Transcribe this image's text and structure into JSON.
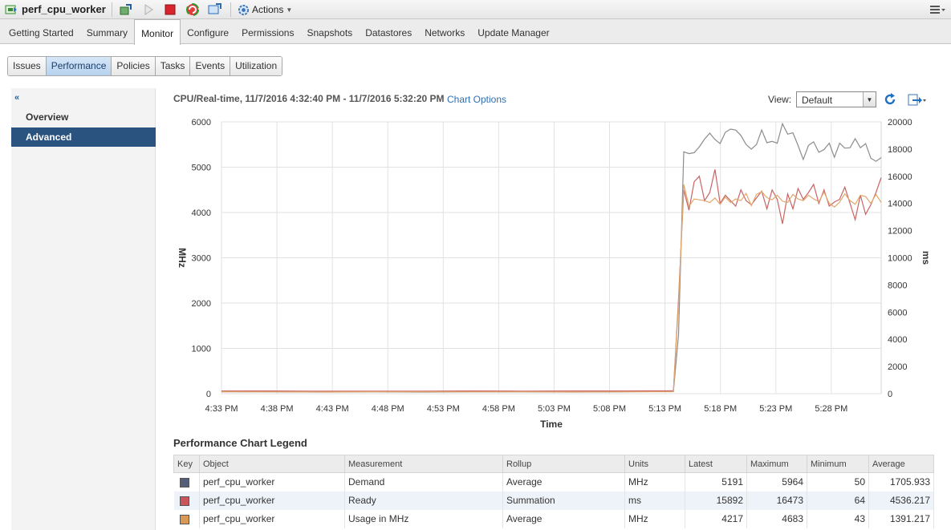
{
  "window": {
    "title": "perf_cpu_worker",
    "actions_label": "Actions"
  },
  "main_tabs": [
    {
      "label": "Getting Started"
    },
    {
      "label": "Summary"
    },
    {
      "label": "Monitor"
    },
    {
      "label": "Configure"
    },
    {
      "label": "Permissions"
    },
    {
      "label": "Snapshots"
    },
    {
      "label": "Datastores"
    },
    {
      "label": "Networks"
    },
    {
      "label": "Update Manager"
    }
  ],
  "active_main_tab": "Monitor",
  "sub_tabs": [
    {
      "label": "Issues"
    },
    {
      "label": "Performance"
    },
    {
      "label": "Policies"
    },
    {
      "label": "Tasks"
    },
    {
      "label": "Events"
    },
    {
      "label": "Utilization"
    }
  ],
  "active_sub_tab": "Performance",
  "left_nav": {
    "items": [
      {
        "label": "Overview"
      },
      {
        "label": "Advanced"
      }
    ],
    "active": "Advanced"
  },
  "chart_header": {
    "title": "CPU/Real-time, 11/7/2016 4:32:40 PM - 11/7/2016 5:32:20 PM",
    "options_link": "Chart Options",
    "view_label": "View:",
    "view_value": "Default"
  },
  "chart_data": {
    "type": "line",
    "xlabel": "Time",
    "ylabel_left": "MHz",
    "ylabel_right": "ms",
    "x_ticks": [
      "4:33 PM",
      "4:38 PM",
      "4:43 PM",
      "4:48 PM",
      "4:53 PM",
      "4:58 PM",
      "5:03 PM",
      "5:08 PM",
      "5:13 PM",
      "5:18 PM",
      "5:23 PM",
      "5:28 PM"
    ],
    "y_left_ticks": [
      0,
      1000,
      2000,
      3000,
      4000,
      5000,
      6000
    ],
    "y_right_ticks": [
      0,
      2000,
      4000,
      6000,
      8000,
      10000,
      12000,
      14000,
      16000,
      18000,
      20000
    ],
    "ylim_left": [
      0,
      6000
    ],
    "ylim_right": [
      0,
      20000
    ],
    "grid": true,
    "series": [
      {
        "name": "Demand",
        "color": "#8c8c8c",
        "axis": "left",
        "values": [
          40,
          40,
          35,
          40,
          35,
          40,
          40,
          35,
          40,
          50,
          1300,
          5340,
          5300,
          5320,
          5450,
          5620,
          5750,
          5610,
          5520,
          5770,
          5840,
          5820,
          5700,
          5500,
          5400,
          5500,
          5820,
          5540,
          5570,
          5530,
          5960,
          5730,
          5760,
          5480,
          5170,
          5480,
          5560,
          5330,
          5390,
          5530,
          5220,
          5530,
          5420,
          5430,
          5630,
          5430,
          5520,
          5200,
          5130,
          5210
        ]
      },
      {
        "name": "Ready",
        "color": "#c96464",
        "axis": "right",
        "values": [
          200,
          200,
          180,
          190,
          190,
          200,
          190,
          200,
          200,
          210,
          7000,
          15000,
          13500,
          15600,
          16000,
          14200,
          14800,
          16500,
          14000,
          14600,
          14200,
          13800,
          15000,
          14200,
          13900,
          14400,
          14900,
          13600,
          15000,
          14300,
          12500,
          14700,
          13600,
          15100,
          14300,
          14800,
          15400,
          14000,
          15000,
          13800,
          14100,
          14300,
          15200,
          14000,
          12800,
          14600,
          13200,
          13900,
          14800,
          15900
        ]
      },
      {
        "name": "Usage in MHz",
        "color": "#e0a76a",
        "axis": "left",
        "values": [
          45,
          40,
          38,
          42,
          40,
          40,
          40,
          38,
          42,
          45,
          2000,
          4620,
          4140,
          4300,
          4280,
          4260,
          4220,
          4320,
          4180,
          4340,
          4220,
          4300,
          4260,
          4420,
          4150,
          4400,
          4460,
          4330,
          4280,
          4380,
          4250,
          4220,
          4400,
          4300,
          4260,
          4380,
          4300,
          4240,
          4450,
          4200,
          4120,
          4230,
          4410,
          4260,
          4180,
          4380,
          4350,
          4200,
          4400,
          4220
        ]
      }
    ]
  },
  "legend": {
    "title": "Performance Chart Legend",
    "headers": [
      "Key",
      "Object",
      "Measurement",
      "Rollup",
      "Units",
      "Latest",
      "Maximum",
      "Minimum",
      "Average"
    ],
    "rows": [
      {
        "color": "#555e78",
        "object": "perf_cpu_worker",
        "measurement": "Demand",
        "rollup": "Average",
        "units": "MHz",
        "latest": "5191",
        "maximum": "5964",
        "minimum": "50",
        "average": "1705.933"
      },
      {
        "color": "#c9545c",
        "object": "perf_cpu_worker",
        "measurement": "Ready",
        "rollup": "Summation",
        "units": "ms",
        "latest": "15892",
        "maximum": "16473",
        "minimum": "64",
        "average": "4536.217"
      },
      {
        "color": "#d89a55",
        "object": "perf_cpu_worker",
        "measurement": "Usage in MHz",
        "rollup": "Average",
        "units": "MHz",
        "latest": "4217",
        "maximum": "4683",
        "minimum": "43",
        "average": "1391.217"
      }
    ]
  }
}
